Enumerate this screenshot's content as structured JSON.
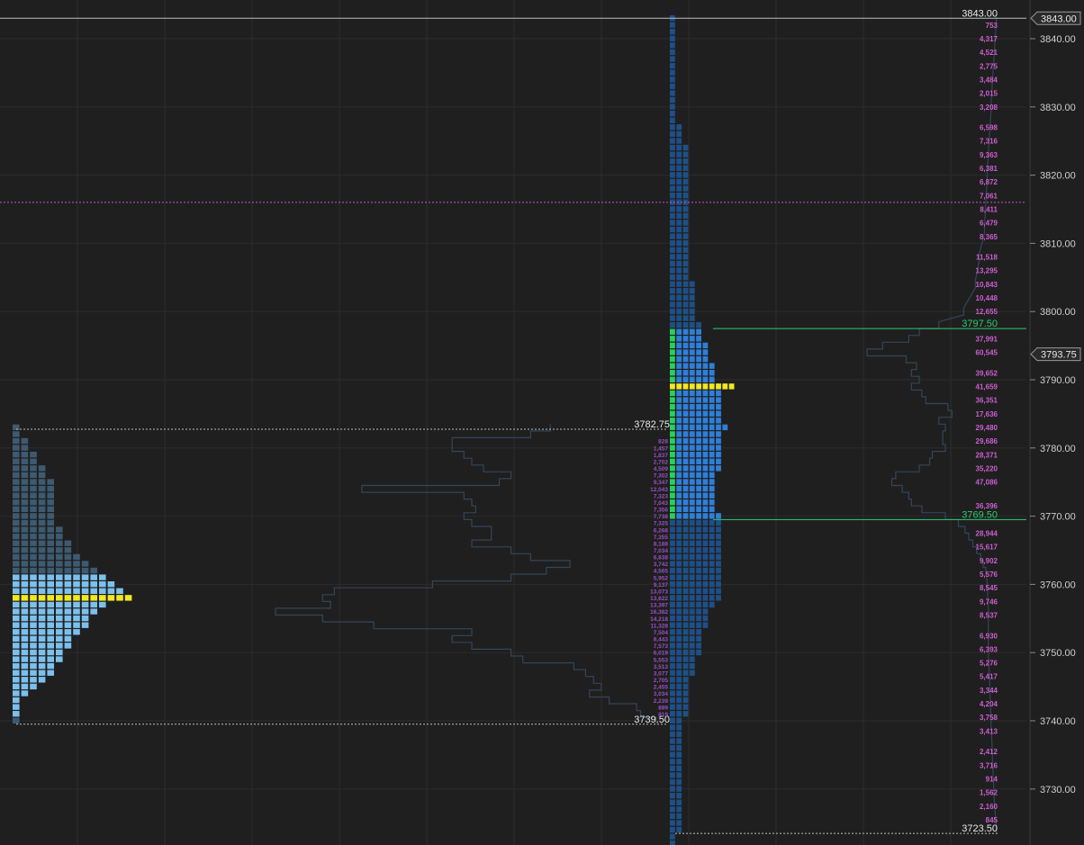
{
  "chart_data": {
    "type": "market-profile",
    "price_axis": {
      "ticks": [
        "3840.00",
        "3830.00",
        "3820.00",
        "3810.00",
        "3800.00",
        "3790.00",
        "3780.00",
        "3770.00",
        "3760.00",
        "3750.00",
        "3740.00",
        "3730.00"
      ],
      "tick_values": [
        3840,
        3830,
        3820,
        3810,
        3800,
        3790,
        3780,
        3770,
        3760,
        3750,
        3740,
        3730
      ],
      "last_price_tag": "3843.00",
      "last_price": 3843.0,
      "current_price_tag": "3793.75",
      "current_price": 3793.75,
      "range": [
        3722.5,
        3845
      ]
    },
    "levels": [
      {
        "label": "3843.00",
        "price": 3843.0,
        "kind": "top"
      },
      {
        "label": "3797.50",
        "price": 3797.5,
        "kind": "value-area-high"
      },
      {
        "label": "3769.50",
        "price": 3769.5,
        "kind": "value-area-low"
      },
      {
        "label": "3782.75",
        "price": 3782.75,
        "kind": "prior-high"
      },
      {
        "label": "3739.50",
        "price": 3739.5,
        "kind": "prior-low"
      },
      {
        "label": "3723.50",
        "price": 3723.5,
        "kind": "low"
      }
    ],
    "reference_line_price": 3816.0,
    "right_volume_labels": [
      {
        "p": 3842.0,
        "t": "753"
      },
      {
        "p": 3840.0,
        "t": "4,317"
      },
      {
        "p": 3838.0,
        "t": "4,521"
      },
      {
        "p": 3836.0,
        "t": "2,775"
      },
      {
        "p": 3834.0,
        "t": "3,484"
      },
      {
        "p": 3832.0,
        "t": "2,015"
      },
      {
        "p": 3830.0,
        "t": "3,208"
      },
      {
        "p": 3827.0,
        "t": "6,598"
      },
      {
        "p": 3825.0,
        "t": "7,316"
      },
      {
        "p": 3823.0,
        "t": "9,363"
      },
      {
        "p": 3821.0,
        "t": "6,381"
      },
      {
        "p": 3819.0,
        "t": "6,872"
      },
      {
        "p": 3817.0,
        "t": "7,061"
      },
      {
        "p": 3815.0,
        "t": "8,411"
      },
      {
        "p": 3813.0,
        "t": "6,479"
      },
      {
        "p": 3811.0,
        "t": "8,365"
      },
      {
        "p": 3808.0,
        "t": "11,518"
      },
      {
        "p": 3806.0,
        "t": "13,295"
      },
      {
        "p": 3804.0,
        "t": "10,843"
      },
      {
        "p": 3802.0,
        "t": "10,448"
      },
      {
        "p": 3800.0,
        "t": "12,655"
      },
      {
        "p": 3796.0,
        "t": "37,991"
      },
      {
        "p": 3794.0,
        "t": "60,545"
      },
      {
        "p": 3791.0,
        "t": "39,652"
      },
      {
        "p": 3789.0,
        "t": "41,659"
      },
      {
        "p": 3787.0,
        "t": "36,351"
      },
      {
        "p": 3785.0,
        "t": "17,636"
      },
      {
        "p": 3783.0,
        "t": "29,480"
      },
      {
        "p": 3781.0,
        "t": "29,686"
      },
      {
        "p": 3779.0,
        "t": "28,371"
      },
      {
        "p": 3777.0,
        "t": "35,220"
      },
      {
        "p": 3775.0,
        "t": "47,086"
      },
      {
        "p": 3771.5,
        "t": "36,396"
      },
      {
        "p": 3767.5,
        "t": "28,944"
      },
      {
        "p": 3765.5,
        "t": "15,617"
      },
      {
        "p": 3763.5,
        "t": "9,902"
      },
      {
        "p": 3761.5,
        "t": "5,576"
      },
      {
        "p": 3759.5,
        "t": "8,545"
      },
      {
        "p": 3757.5,
        "t": "9,746"
      },
      {
        "p": 3755.5,
        "t": "8,537"
      },
      {
        "p": 3752.5,
        "t": "6,930"
      },
      {
        "p": 3750.5,
        "t": "6,393"
      },
      {
        "p": 3748.5,
        "t": "5,276"
      },
      {
        "p": 3746.5,
        "t": "5,417"
      },
      {
        "p": 3744.5,
        "t": "3,344"
      },
      {
        "p": 3742.5,
        "t": "4,204"
      },
      {
        "p": 3740.5,
        "t": "3,758"
      },
      {
        "p": 3738.5,
        "t": "3,413"
      },
      {
        "p": 3735.5,
        "t": "2,412"
      },
      {
        "p": 3733.5,
        "t": "3,716"
      },
      {
        "p": 3731.5,
        "t": "914"
      },
      {
        "p": 3729.5,
        "t": "1,562"
      },
      {
        "p": 3727.5,
        "t": "2,160"
      },
      {
        "p": 3725.5,
        "t": "845"
      }
    ],
    "middle_volume_labels": [
      {
        "p": 3781.0,
        "t": "828"
      },
      {
        "p": 3780.0,
        "t": "1,457"
      },
      {
        "p": 3779.0,
        "t": "1,837"
      },
      {
        "p": 3778.0,
        "t": "2,702"
      },
      {
        "p": 3777.0,
        "t": "4,509"
      },
      {
        "p": 3776.0,
        "t": "7,302"
      },
      {
        "p": 3775.0,
        "t": "9,347"
      },
      {
        "p": 3774.0,
        "t": "12,043"
      },
      {
        "p": 3773.0,
        "t": "7,323"
      },
      {
        "p": 3772.0,
        "t": "7,043"
      },
      {
        "p": 3771.0,
        "t": "7,356"
      },
      {
        "p": 3770.0,
        "t": "7,738"
      },
      {
        "p": 3769.0,
        "t": "7,325"
      },
      {
        "p": 3768.0,
        "t": "6,268"
      },
      {
        "p": 3767.0,
        "t": "7,355"
      },
      {
        "p": 3766.0,
        "t": "8,188"
      },
      {
        "p": 3765.0,
        "t": "7,034"
      },
      {
        "p": 3764.0,
        "t": "6,838"
      },
      {
        "p": 3763.0,
        "t": "3,742"
      },
      {
        "p": 3762.0,
        "t": "4,565"
      },
      {
        "p": 3761.0,
        "t": "5,952"
      },
      {
        "p": 3760.0,
        "t": "9,137"
      },
      {
        "p": 3759.0,
        "t": "13,073"
      },
      {
        "p": 3758.0,
        "t": "13,622"
      },
      {
        "p": 3757.0,
        "t": "13,397"
      },
      {
        "p": 3756.0,
        "t": "16,382"
      },
      {
        "p": 3755.0,
        "t": "14,218"
      },
      {
        "p": 3754.0,
        "t": "11,328"
      },
      {
        "p": 3753.0,
        "t": "7,504"
      },
      {
        "p": 3752.0,
        "t": "8,443"
      },
      {
        "p": 3751.0,
        "t": "7,573"
      },
      {
        "p": 3750.0,
        "t": "6,019"
      },
      {
        "p": 3749.0,
        "t": "5,553"
      },
      {
        "p": 3748.0,
        "t": "3,513"
      },
      {
        "p": 3747.0,
        "t": "3,077"
      },
      {
        "p": 3746.0,
        "t": "2,705"
      },
      {
        "p": 3745.0,
        "t": "2,455"
      },
      {
        "p": 3744.0,
        "t": "3,034"
      },
      {
        "p": 3743.0,
        "t": "2,239"
      },
      {
        "p": 3742.0,
        "t": "889"
      },
      {
        "p": 3741.0,
        "t": "819"
      }
    ],
    "left_profile": {
      "from_price": 3783.0,
      "row_step": 1.0,
      "counts": [
        1,
        1,
        2,
        2,
        3,
        3,
        4,
        4,
        5,
        5,
        5,
        5,
        5,
        5,
        5,
        6,
        6,
        7,
        7,
        8,
        9,
        10,
        11,
        12,
        13,
        11,
        11,
        10,
        9,
        9,
        8,
        7,
        7,
        6,
        6,
        5,
        5,
        4,
        3,
        2,
        1,
        1,
        1,
        1
      ],
      "value_area": [
        3741.0,
        3761.0
      ],
      "poc_price": 3758.0,
      "poc_count": 14
    },
    "main_profile": {
      "from_price": 3843.0,
      "row_step": 1.0,
      "counts": [
        1,
        1,
        1,
        1,
        1,
        1,
        1,
        1,
        1,
        1,
        1,
        1,
        1,
        1,
        1,
        1,
        2,
        2,
        2,
        3,
        3,
        3,
        3,
        3,
        3,
        3,
        3,
        3,
        3,
        3,
        3,
        3,
        3,
        3,
        3,
        3,
        3,
        3,
        3,
        4,
        4,
        4,
        4,
        4,
        4,
        5,
        5,
        5,
        6,
        6,
        6,
        7,
        7,
        7,
        8,
        8,
        8,
        8,
        8,
        8,
        9,
        8,
        8,
        8,
        8,
        8,
        8,
        7,
        7,
        7,
        7,
        7,
        7,
        8,
        8,
        8,
        8,
        8,
        8,
        8,
        8,
        8,
        8,
        8,
        8,
        8,
        7,
        6,
        6,
        6,
        5,
        5,
        5,
        5,
        4,
        4,
        4,
        3,
        3,
        3,
        3,
        3,
        3,
        2,
        2,
        2,
        2,
        2,
        2,
        2,
        2,
        2,
        2,
        2,
        2,
        2,
        2,
        2,
        2,
        2,
        1,
        1
      ],
      "value_area": [
        3769.5,
        3797.5
      ],
      "poc_price": 3789.0,
      "poc_count": 10,
      "initial_balance": [
        3770.0,
        3797.5
      ]
    },
    "volume_outline_left": [
      [
        3783,
        0.3
      ],
      [
        3782,
        0.35
      ],
      [
        3781,
        0.55
      ],
      [
        3780,
        0.55
      ],
      [
        3779,
        0.52
      ],
      [
        3778,
        0.5
      ],
      [
        3777,
        0.47
      ],
      [
        3776,
        0.4
      ],
      [
        3775,
        0.43
      ],
      [
        3774,
        0.78
      ],
      [
        3773,
        0.52
      ],
      [
        3772,
        0.5
      ],
      [
        3771,
        0.49
      ],
      [
        3770,
        0.52
      ],
      [
        3769,
        0.5
      ],
      [
        3768,
        0.45
      ],
      [
        3767,
        0.45
      ],
      [
        3766,
        0.5
      ],
      [
        3765,
        0.4
      ],
      [
        3764,
        0.35
      ],
      [
        3763,
        0.25
      ],
      [
        3762,
        0.31
      ],
      [
        3761,
        0.4
      ],
      [
        3760,
        0.6
      ],
      [
        3759,
        0.85
      ],
      [
        3758,
        0.88
      ],
      [
        3757,
        0.86
      ],
      [
        3756,
        1.0
      ],
      [
        3755,
        0.88
      ],
      [
        3754,
        0.75
      ],
      [
        3753,
        0.5
      ],
      [
        3752,
        0.55
      ],
      [
        3751,
        0.5
      ],
      [
        3750,
        0.4
      ],
      [
        3749,
        0.37
      ],
      [
        3748,
        0.24
      ],
      [
        3747,
        0.21
      ],
      [
        3746,
        0.19
      ],
      [
        3745,
        0.17
      ],
      [
        3744,
        0.2
      ],
      [
        3743,
        0.15
      ],
      [
        3742,
        0.08
      ],
      [
        3741,
        0.07
      ],
      [
        3740,
        0.03
      ]
    ],
    "volume_outline_right": [
      [
        3843,
        0.01
      ],
      [
        3830,
        0.05
      ],
      [
        3820,
        0.08
      ],
      [
        3812,
        0.1
      ],
      [
        3808,
        0.14
      ],
      [
        3804,
        0.17
      ],
      [
        3800,
        0.26
      ],
      [
        3798,
        0.45
      ],
      [
        3797,
        0.6
      ],
      [
        3796,
        0.68
      ],
      [
        3795,
        0.88
      ],
      [
        3794,
        1.0
      ],
      [
        3793,
        0.7
      ],
      [
        3792,
        0.62
      ],
      [
        3791,
        0.66
      ],
      [
        3790,
        0.6
      ],
      [
        3789,
        0.66
      ],
      [
        3788,
        0.58
      ],
      [
        3787,
        0.55
      ],
      [
        3786,
        0.38
      ],
      [
        3785,
        0.35
      ],
      [
        3784,
        0.45
      ],
      [
        3783,
        0.4
      ],
      [
        3782,
        0.42
      ],
      [
        3781,
        0.42
      ],
      [
        3780,
        0.4
      ],
      [
        3779,
        0.5
      ],
      [
        3778,
        0.52
      ],
      [
        3777,
        0.6
      ],
      [
        3776,
        0.78
      ],
      [
        3775,
        0.81
      ],
      [
        3774,
        0.73
      ],
      [
        3773,
        0.68
      ],
      [
        3772,
        0.66
      ],
      [
        3771,
        0.58
      ],
      [
        3770,
        0.4
      ],
      [
        3769,
        0.3
      ],
      [
        3768,
        0.25
      ],
      [
        3767,
        0.22
      ],
      [
        3766,
        0.19
      ],
      [
        3765,
        0.16
      ],
      [
        3764,
        0.13
      ],
      [
        3763,
        0.11
      ],
      [
        3762,
        0.09
      ],
      [
        3760,
        0.08
      ],
      [
        3756,
        0.07
      ],
      [
        3750,
        0.07
      ],
      [
        3745,
        0.06
      ],
      [
        3740,
        0.05
      ],
      [
        3735,
        0.04
      ],
      [
        3730,
        0.03
      ],
      [
        3724,
        0.01
      ]
    ]
  },
  "colors": {
    "background": "#1f1f1f",
    "grid": "#2c2c2c",
    "axis_text": "#cfcfcf",
    "profile_blue": "#2f7fd9",
    "profile_dark": "#1f4f86",
    "left_light": "#7cc0ec",
    "left_dark": "#3d5a70",
    "poc_yellow": "#f2e81e",
    "ib_green": "#27d15e",
    "volume_text": "#cc5fd0",
    "outline": "#34455a",
    "level_green": "#2ecc71",
    "reference_pink": "#c05ac8"
  }
}
